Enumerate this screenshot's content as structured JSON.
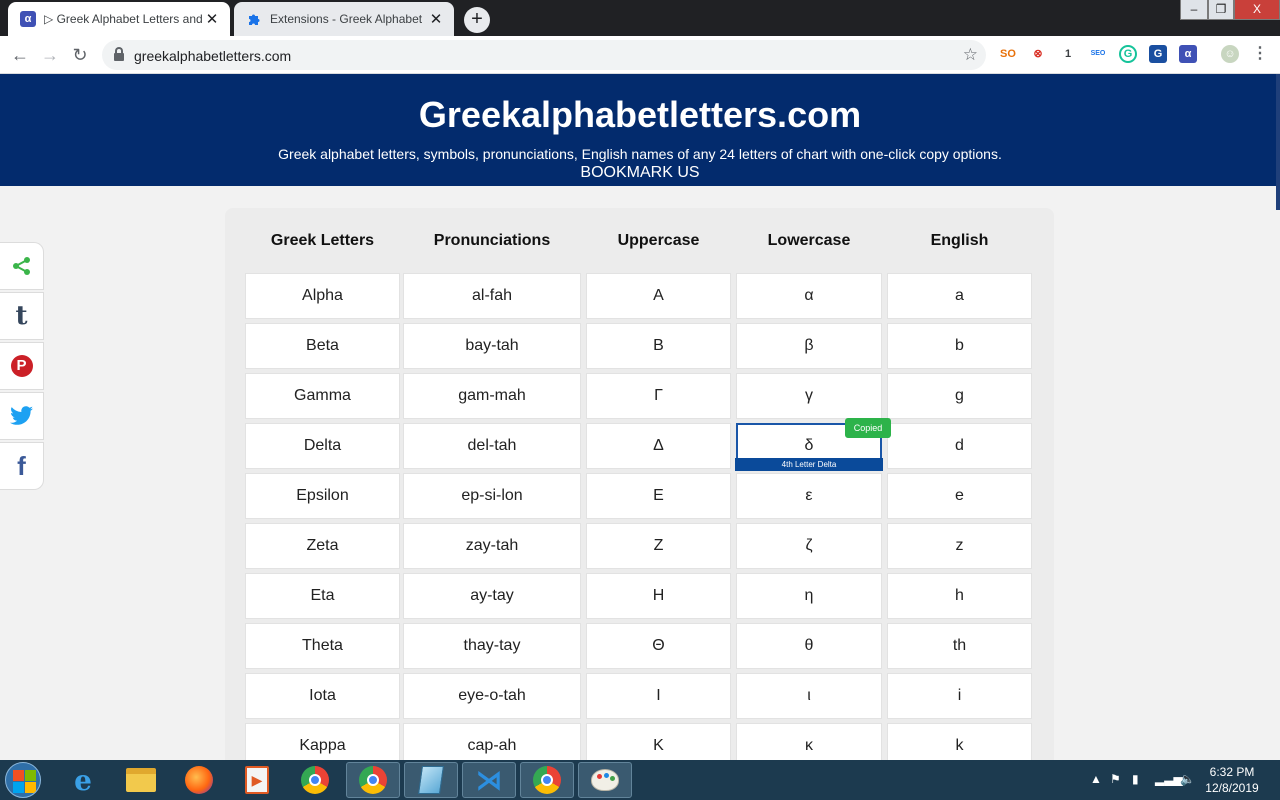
{
  "browser": {
    "tabs": [
      {
        "title": "▷ Greek Alphabet Letters and Sy",
        "favicon": "α",
        "active": true
      },
      {
        "title": "Extensions - Greek Alphabet",
        "favicon": "puzzle-icon",
        "active": false
      }
    ],
    "window_controls": {
      "minimize": "–",
      "maximize": "❐",
      "close": "X"
    },
    "address": "greekalphabetletters.com",
    "extensions": [
      {
        "name": "seo-extension-icon",
        "label": "SO",
        "color": "#e8710a"
      },
      {
        "name": "adblock-extension-icon",
        "label": "⊗",
        "color": "#d93025"
      },
      {
        "name": "number-extension-icon",
        "label": "1",
        "color": "#3c4043"
      },
      {
        "name": "seo-quake-icon",
        "label": "SEO",
        "color": "#1a73e8"
      },
      {
        "name": "grammarly-icon",
        "label": "G",
        "color": "#15c39a"
      },
      {
        "name": "translate-extension-icon",
        "label": "G",
        "color": "#1a4fa0"
      },
      {
        "name": "greek-alphabet-extension-icon",
        "label": "α",
        "color": "#3f51b5"
      }
    ]
  },
  "site": {
    "title": "Greekalphabetletters.com",
    "subtitle": "Greek alphabet letters, symbols, pronunciations, English names of any 24 letters of chart with one-click copy options.",
    "bookmark": "BOOKMARK US"
  },
  "share": [
    {
      "name": "share-icon",
      "symbol": "share",
      "color": "#3bb54a"
    },
    {
      "name": "tumblr-icon",
      "symbol": "t",
      "color": "#35465c"
    },
    {
      "name": "pinterest-icon",
      "symbol": "P",
      "color": "#cb2027"
    },
    {
      "name": "twitter-icon",
      "symbol": "bird",
      "color": "#1da1f2"
    },
    {
      "name": "facebook-icon",
      "symbol": "f",
      "color": "#3b5998"
    }
  ],
  "table": {
    "headers": [
      "Greek Letters",
      "Pronunciations",
      "Uppercase",
      "Lowercase",
      "English"
    ],
    "rows": [
      [
        "Alpha",
        "al-fah",
        "Α",
        "α",
        "a"
      ],
      [
        "Beta",
        "bay-tah",
        "Β",
        "β",
        "b"
      ],
      [
        "Gamma",
        "gam-mah",
        "Γ",
        "γ",
        "g"
      ],
      [
        "Delta",
        "del-tah",
        "Δ",
        "δ",
        "d"
      ],
      [
        "Epsilon",
        "ep-si-lon",
        "Ε",
        "ε",
        "e"
      ],
      [
        "Zeta",
        "zay-tah",
        "Ζ",
        "ζ",
        "z"
      ],
      [
        "Eta",
        "ay-tay",
        "Η",
        "η",
        "h"
      ],
      [
        "Theta",
        "thay-tay",
        "Θ",
        "θ",
        "th"
      ],
      [
        "Iota",
        "eye-o-tah",
        "Ι",
        "ι",
        "i"
      ],
      [
        "Kappa",
        "cap-ah",
        "Κ",
        "κ",
        "k"
      ]
    ],
    "selected": {
      "row": 3,
      "col": 3
    },
    "tooltip": "4th Letter Delta",
    "copied_badge": "Copied"
  },
  "taskbar": {
    "apps": [
      {
        "name": "internet-explorer-icon",
        "open": false
      },
      {
        "name": "file-explorer-icon",
        "open": false
      },
      {
        "name": "firefox-icon",
        "open": false
      },
      {
        "name": "media-player-icon",
        "open": false
      },
      {
        "name": "chrome-icon",
        "open": false
      },
      {
        "name": "chrome-profile-icon",
        "open": true
      },
      {
        "name": "notepad-icon",
        "open": true
      },
      {
        "name": "vscode-icon",
        "open": true
      },
      {
        "name": "chrome-window-icon",
        "open": true
      },
      {
        "name": "paint-icon",
        "open": true
      }
    ],
    "time": "6:32 PM",
    "date": "12/8/2019"
  }
}
